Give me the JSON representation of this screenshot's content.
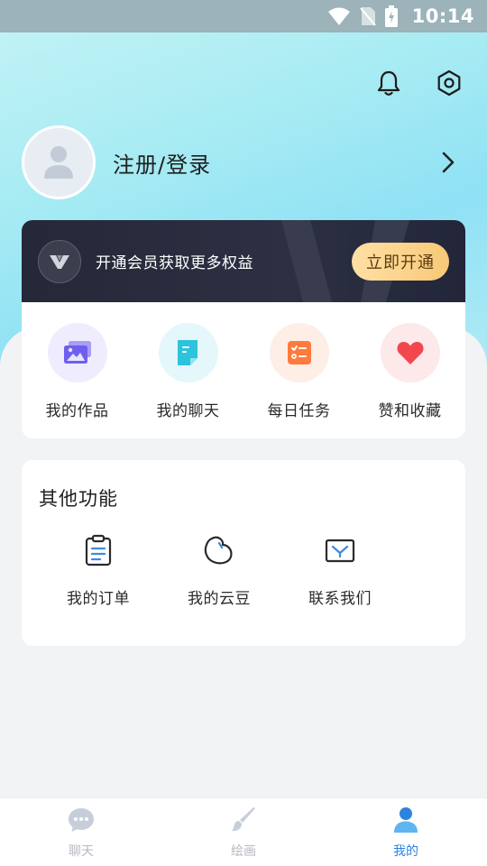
{
  "status_bar": {
    "time": "10:14"
  },
  "header": {
    "icons": [
      "bell-icon",
      "settings-gear-icon"
    ]
  },
  "profile": {
    "login_label": "注册/登录",
    "avatar_icon": "user-placeholder-icon",
    "chevron_icon": "chevron-right-icon"
  },
  "vip": {
    "text": "开通会员获取更多权益",
    "button_label": "立即开通",
    "badge_icon": "vip-v-badge-icon"
  },
  "features": [
    {
      "label": "我的作品",
      "icon": "gallery-icon",
      "color": "#7b6cf0",
      "bg": "#efedfd"
    },
    {
      "label": "我的聊天",
      "icon": "chat-doc-icon",
      "color": "#2cc3dc",
      "bg": "#e4f7fb"
    },
    {
      "label": "每日任务",
      "icon": "task-list-icon",
      "color": "#ff7a3d",
      "bg": "#fdeee6"
    },
    {
      "label": "赞和收藏",
      "icon": "heart-icon",
      "color": "#f2474f",
      "bg": "#fde9ea"
    }
  ],
  "other": {
    "title": "其他功能",
    "items": [
      {
        "label": "我的订单",
        "icon": "clipboard-order-icon"
      },
      {
        "label": "我的云豆",
        "icon": "bean-icon"
      },
      {
        "label": "联系我们",
        "icon": "mail-icon"
      }
    ]
  },
  "bottom_nav": [
    {
      "label": "聊天",
      "icon": "chat-bubble-icon",
      "active": false
    },
    {
      "label": "绘画",
      "icon": "paint-brush-icon",
      "active": false
    },
    {
      "label": "我的",
      "icon": "person-icon",
      "active": true
    }
  ],
  "colors": {
    "accent": "#2d84e0",
    "vip_button": "#f8c977",
    "vip_banner": "#252838"
  }
}
